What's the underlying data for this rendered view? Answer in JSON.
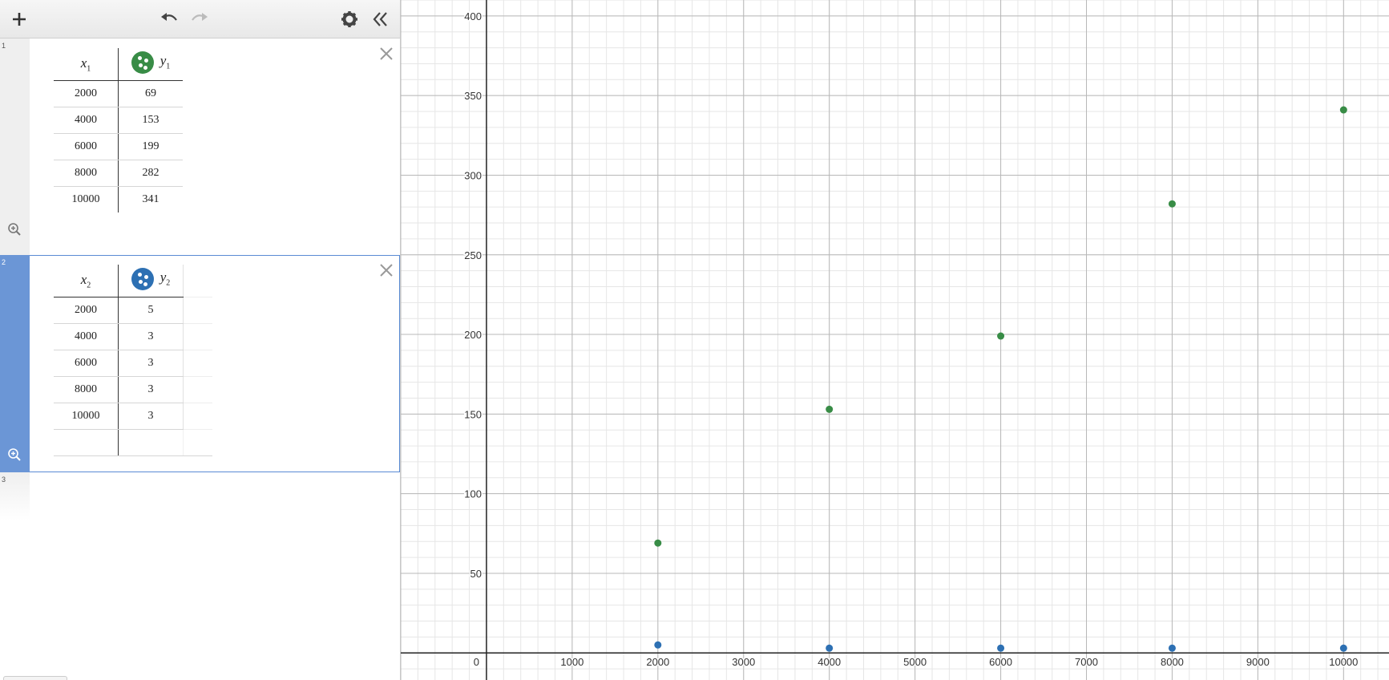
{
  "expressions": [
    {
      "number": "1",
      "x_var": "x",
      "x_sub": "1",
      "y_var": "y",
      "y_sub": "1",
      "color": "#388c46",
      "rows": [
        {
          "x": "2000",
          "y": "69"
        },
        {
          "x": "4000",
          "y": "153"
        },
        {
          "x": "6000",
          "y": "199"
        },
        {
          "x": "8000",
          "y": "282"
        },
        {
          "x": "10000",
          "y": "341"
        }
      ]
    },
    {
      "number": "2",
      "x_var": "x",
      "x_sub": "2",
      "y_var": "y",
      "y_sub": "2",
      "color": "#2d70b3",
      "rows": [
        {
          "x": "2000",
          "y": "5"
        },
        {
          "x": "4000",
          "y": "3"
        },
        {
          "x": "6000",
          "y": "3"
        },
        {
          "x": "8000",
          "y": "3"
        },
        {
          "x": "10000",
          "y": "3"
        }
      ]
    },
    {
      "number": "3"
    }
  ],
  "chart_data": {
    "type": "scatter",
    "xlim": [
      -1000,
      10530
    ],
    "ylim": [
      -17,
      410
    ],
    "x_ticks": [
      0,
      1000,
      2000,
      3000,
      4000,
      5000,
      6000,
      7000,
      8000,
      9000,
      10000
    ],
    "y_ticks": [
      50,
      100,
      150,
      200,
      250,
      300,
      350,
      400
    ],
    "x_tick_labels": [
      "0",
      "1000",
      "2000",
      "3000",
      "4000",
      "5000",
      "6000",
      "7000",
      "8000",
      "9000",
      "10000"
    ],
    "y_tick_labels": [
      "50",
      "100",
      "150",
      "200",
      "250",
      "300",
      "350",
      "400"
    ],
    "grid": true,
    "series": [
      {
        "color": "#388c46",
        "x": [
          2000,
          4000,
          6000,
          8000,
          10000
        ],
        "y": [
          69,
          153,
          199,
          282,
          341
        ]
      },
      {
        "color": "#2d70b3",
        "x": [
          2000,
          4000,
          6000,
          8000,
          10000
        ],
        "y": [
          5,
          3,
          3,
          3,
          3
        ]
      }
    ]
  }
}
